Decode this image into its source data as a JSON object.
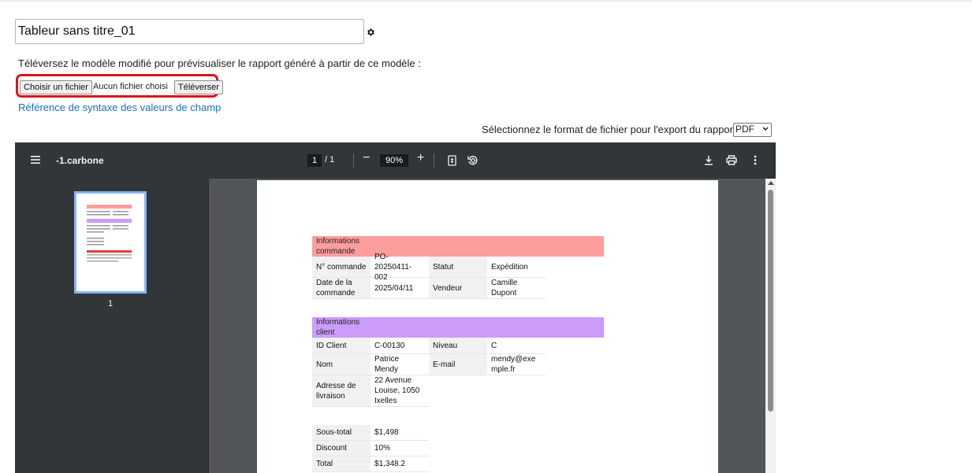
{
  "title_input": {
    "value": "Tableur sans titre_01"
  },
  "instructions": "Téléversez le modèle modifié pour prévisualiser le rapport généré à partir de ce modèle :",
  "upload": {
    "choose_label": "Choisir un fichier",
    "no_file_text": "Aucun fichier choisi",
    "upload_label": "Téléverser"
  },
  "syntax_link": "Référence de syntaxe des valeurs de champ",
  "export": {
    "label": "Sélectionnez le format de fichier pour l'export du rapport :",
    "selected": "PDF"
  },
  "viewer": {
    "doc_name": "-1.carbone",
    "current_page": "1",
    "total_pages": "/ 1",
    "zoom": "90%",
    "thumb_page": "1"
  },
  "document": {
    "order": {
      "title_line1": "Informations",
      "title_line2": "commande",
      "order_no_label": "N° commande",
      "order_no_value_1": "PO-20250411-",
      "order_no_value_2": "002",
      "status_label": "Statut",
      "status_value": "Expédition",
      "date_label_1": "Date de la",
      "date_label_2": "commande",
      "date_value": "2025/04/11",
      "seller_label": "Vendeur",
      "seller_value_1": "Camille",
      "seller_value_2": "Dupont"
    },
    "client": {
      "title_line1": "Informations",
      "title_line2": "client",
      "id_label": "ID Client",
      "id_value": "C-00130",
      "level_label": "Niveau",
      "level_value": "C",
      "name_label": "Nom",
      "name_value_1": "Patrice",
      "name_value_2": "Mendy",
      "email_label": "E-mail",
      "email_value_1": "mendy@exe",
      "email_value_2": "mple.fr",
      "address_label_1": "Adresse de",
      "address_label_2": "livraison",
      "address_value_1": "22 Avenue",
      "address_value_2": "Louise, 1050",
      "address_value_3": "Ixelles"
    },
    "totals": {
      "subtotal_label": "Sous-total",
      "subtotal_value": "$1,498",
      "discount_label": "Discount",
      "discount_value": "10%",
      "total_label": "Total",
      "total_value": "$1,348.2"
    }
  },
  "colors": {
    "highlight": "#d9141b",
    "link": "#1a6fbf",
    "order_header": "#fc9d9e",
    "client_header": "#cb9cf9",
    "viewer_toolbar": "#323639",
    "thumb_border": "#8ab4f8"
  }
}
